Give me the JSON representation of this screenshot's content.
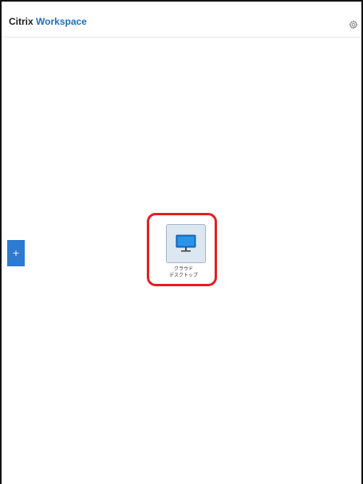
{
  "header": {
    "brand_primary": "Citrix",
    "brand_secondary": "Workspace",
    "settings_icon": "gear-icon"
  },
  "sidebar": {
    "add_label": "+"
  },
  "apps": [
    {
      "name_line1": "クラウド",
      "name_line2": "デスクトップ",
      "icon": "desktop-monitor-icon",
      "highlighted": true
    }
  ],
  "colors": {
    "brand_blue": "#1d6fbd",
    "add_tab_blue": "#2d7bd0",
    "highlight_red": "#e02020",
    "tile_bg": "#dde7f1"
  }
}
